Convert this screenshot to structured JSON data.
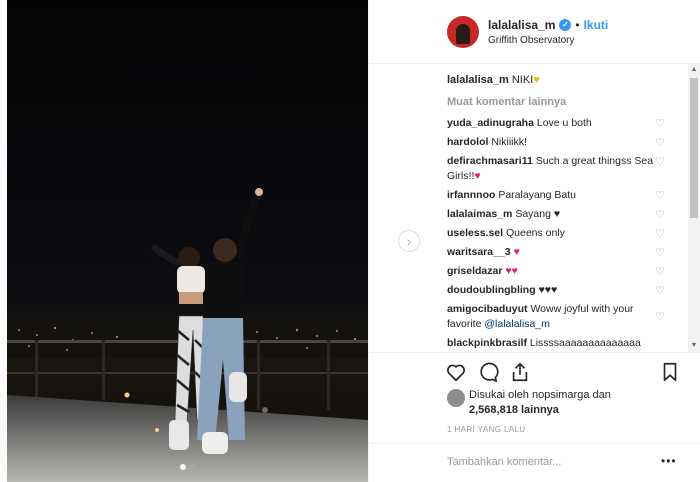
{
  "post": {
    "username": "lalalalisa_m",
    "separator": "•",
    "follow_label": "Ikuti",
    "location": "Griffith Observatory",
    "caption_text": "NIKI",
    "load_more": "Muat komentar lainnya"
  },
  "comments": [
    {
      "user": "yuda_adinugraha",
      "text": "Love u both",
      "emoji": ""
    },
    {
      "user": "hardolol",
      "text": "Nikiiikk!",
      "emoji": ""
    },
    {
      "user": "defirachmasari11",
      "text": "Such a great thingss Sea Girls!!",
      "emoji": "♥"
    },
    {
      "user": "irfannnoo",
      "text": "Paralayang Batu",
      "emoji": ""
    },
    {
      "user": "lalalaimas_m",
      "text": "Sayang",
      "emoji": "♥"
    },
    {
      "user": "useless.sel",
      "text": "Queens only",
      "emoji": ""
    },
    {
      "user": "waritsara__3",
      "text": "",
      "emoji": "♥"
    },
    {
      "user": "griseldazar",
      "text": "",
      "emoji": "♥♥"
    },
    {
      "user": "doudoublingbling",
      "text": "",
      "emoji": "♥♥♥"
    },
    {
      "user": "amigocibaduyut",
      "text": "Woww joyful with your favorite",
      "mention": "@lalalalisa_m",
      "emoji": ""
    },
    {
      "user": "blackpinkbrasilf",
      "text": "Lissssaaaaaaaaaaaaaa",
      "emoji": ""
    }
  ],
  "likes": {
    "line1": "Disukai oleh nopsimarga dan",
    "line2": "2,568,818 lainnya"
  },
  "date": "1 HARI YANG LALU",
  "add_comment_placeholder": "Tambahkan komentar...",
  "options": "•••",
  "icons": {
    "heart": "heart-icon",
    "comment": "comment-icon",
    "share": "share-icon",
    "save": "bookmark-icon",
    "verified": "verified-badge-icon"
  },
  "colors": {
    "accent": "#3897f0",
    "red": "#e0245e",
    "gold": "#f2b600"
  }
}
